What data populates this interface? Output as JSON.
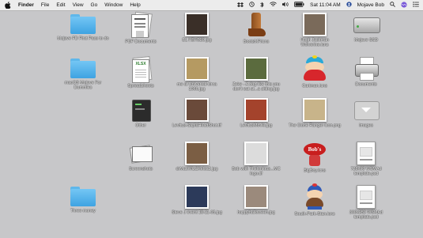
{
  "menubar": {
    "app": "Finder",
    "menus": [
      "File",
      "Edit",
      "View",
      "Go",
      "Window",
      "Help"
    ],
    "clock": "Sat 11:04 AM",
    "user": "Mojave Bob"
  },
  "desktop": {
    "items": [
      {
        "label": "Mojave FD First Pass to do",
        "kind": "folder"
      },
      {
        "label": "PDF Documents",
        "kind": "pdfstack"
      },
      {
        "label": "BL HBH520.jpg",
        "kind": "photo",
        "color": "#3a2f28"
      },
      {
        "label": "BootsMP.icns",
        "kind": "boot"
      },
      {
        "label": "Hugh Jackman Wolverine.icns",
        "kind": "photo",
        "color": "#7a6a5a"
      },
      {
        "label": "Mojave SSD",
        "kind": "drive"
      },
      {
        "label": "macOS Mojave For Dummies",
        "kind": "folder"
      },
      {
        "label": "Spreadsheets",
        "kind": "sheetstack"
      },
      {
        "label": "me at Universal circa 1966.jpg",
        "kind": "photo",
        "color": "#b59a62"
      },
      {
        "label": "Zeke - A dog like this you don't eat at...a sitting.jpg",
        "kind": "photo",
        "color": "#5b6b3e"
      },
      {
        "label": "Cartman.icns",
        "kind": "cartman"
      },
      {
        "label": "Documents",
        "kind": "printer"
      },
      {
        "label": "Other",
        "kind": "other"
      },
      {
        "label": "Levitus-SapiaHeadShot.tif",
        "kind": "photo",
        "color": "#6a4a3a"
      },
      {
        "label": "LevitusMovie.jpg",
        "kind": "photo",
        "color": "#a4432c"
      },
      {
        "label": "The Clone Ranger icon.png",
        "kind": "photo",
        "color": "#c8b48a"
      },
      {
        "label": "Images",
        "kind": "images"
      },
      {
        "label": "Screenshots",
        "kind": "screenstack"
      },
      {
        "label": "drMacWiz&Kelsa2.jpg",
        "kind": "photo",
        "color": "#7b5e44"
      },
      {
        "label": "Bob with Thelonious...MC logo.tif",
        "kind": "photo",
        "color": "#dcdcdc"
      },
      {
        "label": "BigBoy.icns",
        "kind": "bigboy"
      },
      {
        "label": "728x90 WSMAd template.psd",
        "kind": "psd"
      },
      {
        "label": "Three money",
        "kind": "folder"
      },
      {
        "label": "Steve J event 10-11-05.jpg",
        "kind": "photo",
        "color": "#2c3a5a"
      },
      {
        "label": "happyhalloween.jpg",
        "kind": "photo",
        "color": "#9b8a7c"
      },
      {
        "label": "South-Park-Stan.icns",
        "kind": "stan"
      },
      {
        "label": "300x250 WSMAd template.psd",
        "kind": "psd"
      }
    ]
  }
}
